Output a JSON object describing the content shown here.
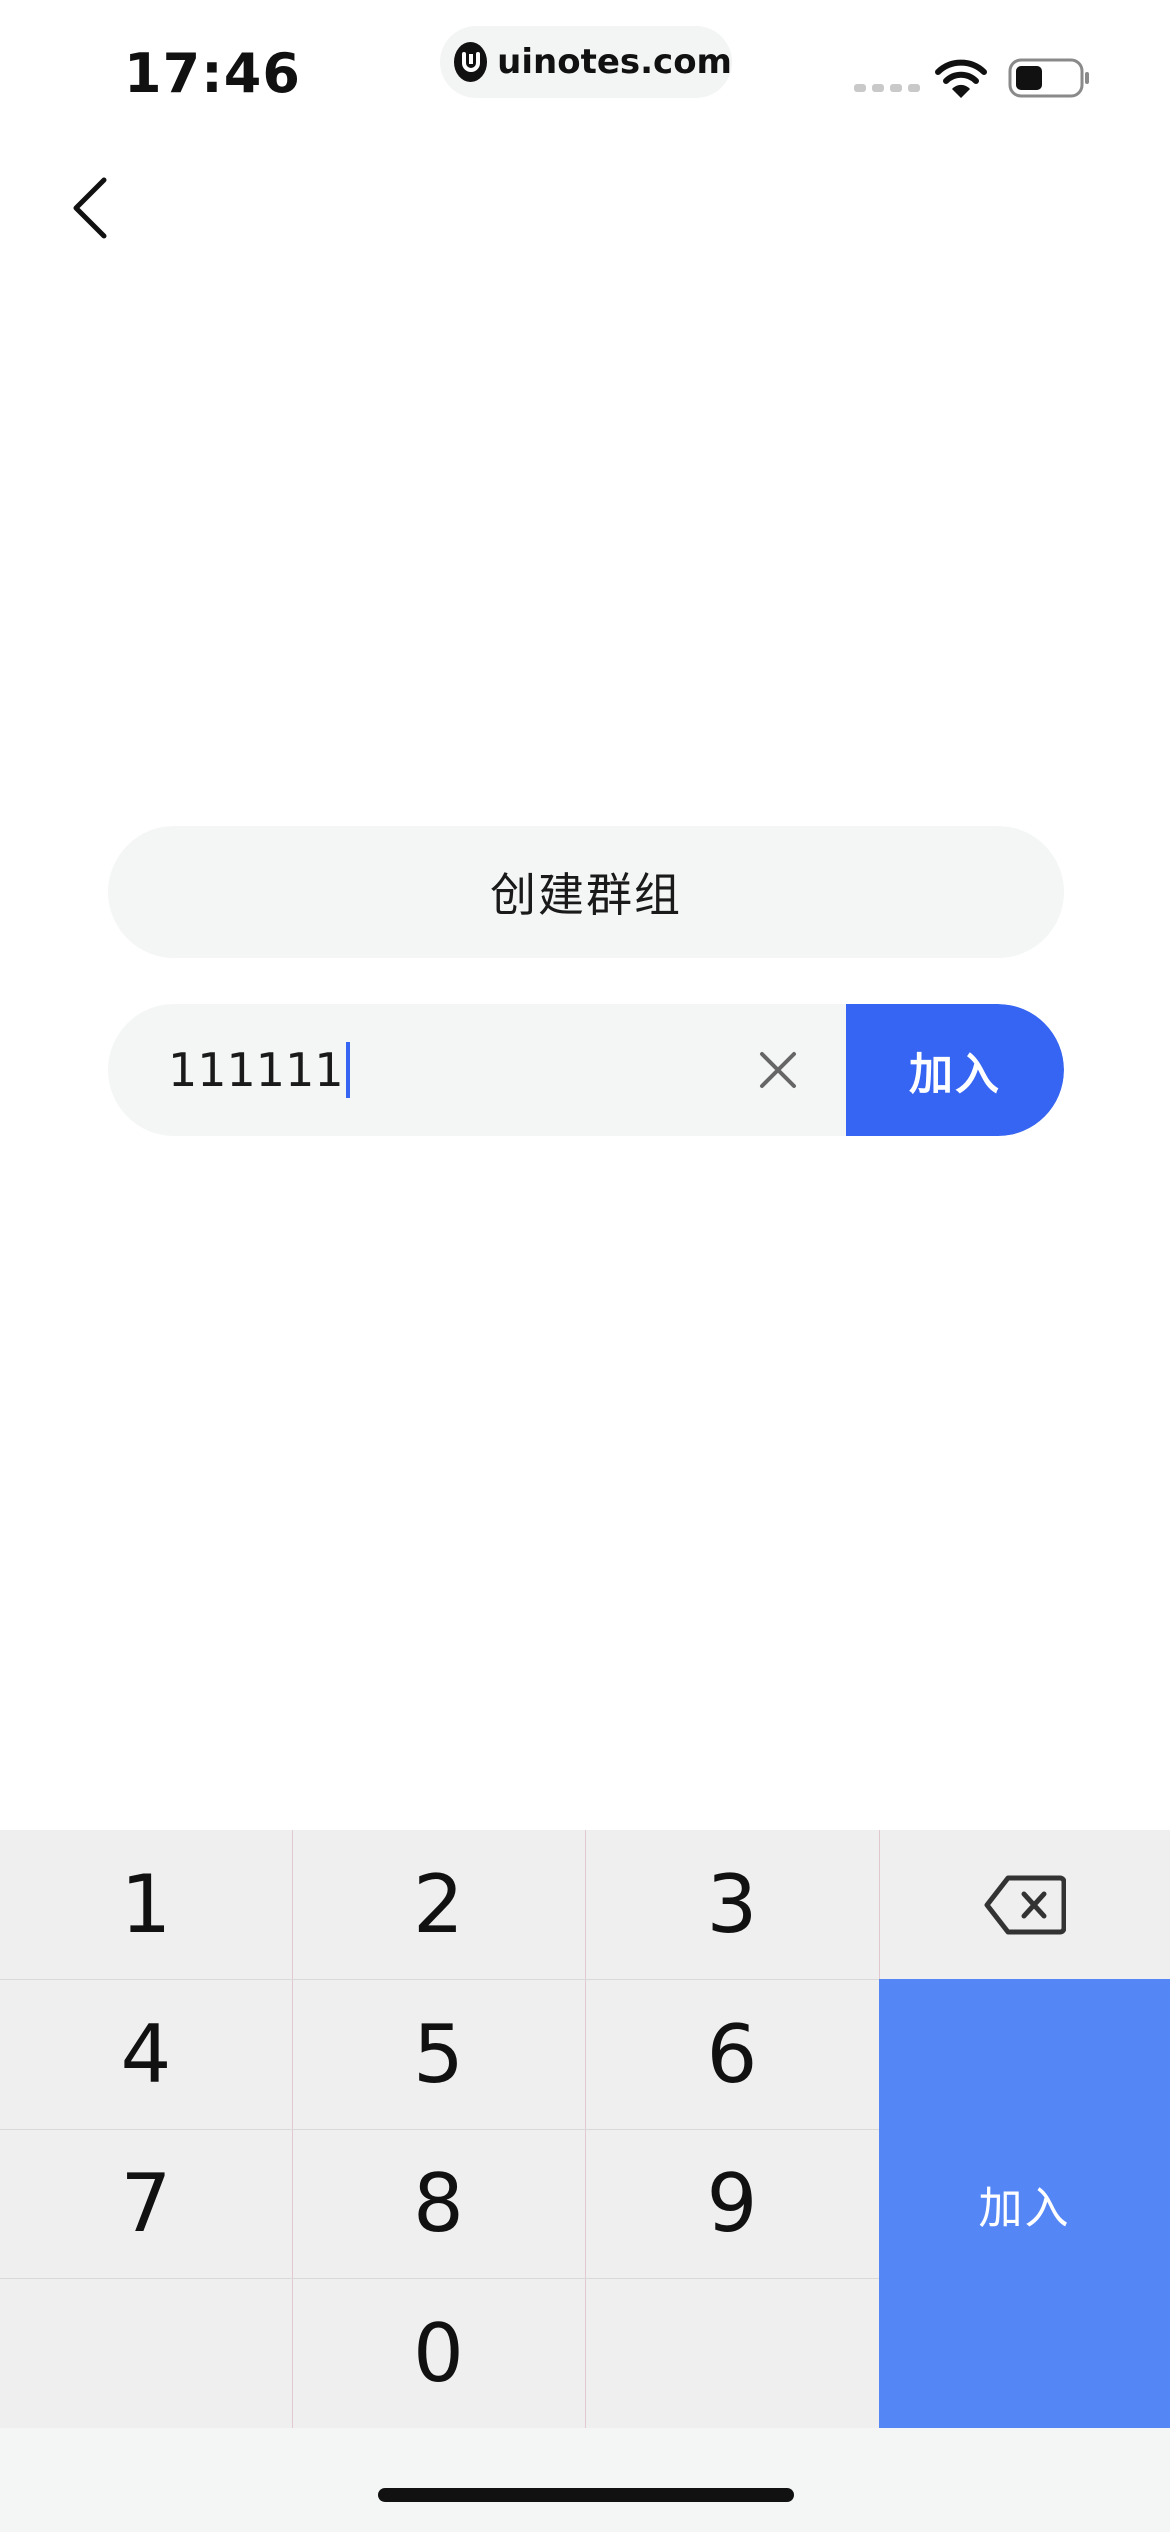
{
  "status_bar": {
    "time": "17:46",
    "url": "uinotes.com"
  },
  "nav": {
    "back_icon": "chevron-left-icon"
  },
  "main": {
    "create_group_label": "创建群组",
    "join_code_value": "111111",
    "join_label": "加入",
    "clear_icon": "close-icon"
  },
  "keypad": {
    "keys": [
      "1",
      "2",
      "3",
      "4",
      "5",
      "6",
      "7",
      "8",
      "9",
      "0"
    ],
    "backspace_icon": "backspace-icon",
    "enter_label": "加入"
  },
  "colors": {
    "accent": "#3565f2",
    "enter_key": "#5487f5",
    "field_bg": "#f4f6f6",
    "keypad_bg": "#efefef"
  }
}
